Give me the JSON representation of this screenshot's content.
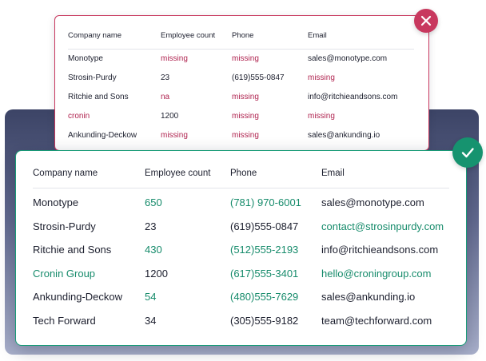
{
  "colors": {
    "error": "#c8385e",
    "success": "#16936f",
    "text": "#1c1f2e"
  },
  "icons": {
    "error_badge": "close-icon",
    "success_badge": "check-icon"
  },
  "before_table": {
    "headers": [
      "Company name",
      "Employee count",
      "Phone",
      "Email"
    ],
    "rows": [
      {
        "company": "Monotype",
        "employees": "missing",
        "phone": "missing",
        "email": "sales@monotype.com"
      },
      {
        "company": "Strosin-Purdy",
        "employees": "23",
        "phone": "(619)555-0847",
        "email": "missing"
      },
      {
        "company": "Ritchie and Sons",
        "employees": "na",
        "phone": "missing",
        "email": "info@ritchieandsons.com"
      },
      {
        "company": "cronin",
        "employees": "1200",
        "phone": "missing",
        "email": "missing"
      },
      {
        "company": "Ankunding-Deckow",
        "employees": "missing",
        "phone": "missing",
        "email": "sales@ankunding.io"
      }
    ],
    "flagged": [
      [
        false,
        true,
        true,
        false
      ],
      [
        false,
        false,
        false,
        true
      ],
      [
        false,
        true,
        true,
        false
      ],
      [
        true,
        false,
        true,
        true
      ],
      [
        false,
        true,
        true,
        false
      ]
    ]
  },
  "after_table": {
    "headers": [
      "Company name",
      "Employee count",
      "Phone",
      "Email"
    ],
    "rows": [
      {
        "company": "Monotype",
        "employees": "650",
        "phone": "(781) 970-6001",
        "email": "sales@monotype.com"
      },
      {
        "company": "Strosin-Purdy",
        "employees": "23",
        "phone": "(619)555-0847",
        "email": "contact@strosinpurdy.com"
      },
      {
        "company": "Ritchie and Sons",
        "employees": "430",
        "phone": "(512)555-2193",
        "email": "info@ritchieandsons.com"
      },
      {
        "company": "Cronin Group",
        "employees": "1200",
        "phone": "(617)555-3401",
        "email": "hello@croningroup.com"
      },
      {
        "company": "Ankunding-Deckow",
        "employees": "54",
        "phone": "(480)555-7629",
        "email": "sales@ankunding.io"
      },
      {
        "company": "Tech Forward",
        "employees": "34",
        "phone": "(305)555-9182",
        "email": "team@techforward.com"
      }
    ],
    "fixed": [
      [
        false,
        true,
        true,
        false
      ],
      [
        false,
        false,
        false,
        true
      ],
      [
        false,
        true,
        true,
        false
      ],
      [
        true,
        false,
        true,
        true
      ],
      [
        false,
        true,
        true,
        false
      ],
      [
        false,
        false,
        false,
        false
      ]
    ]
  }
}
